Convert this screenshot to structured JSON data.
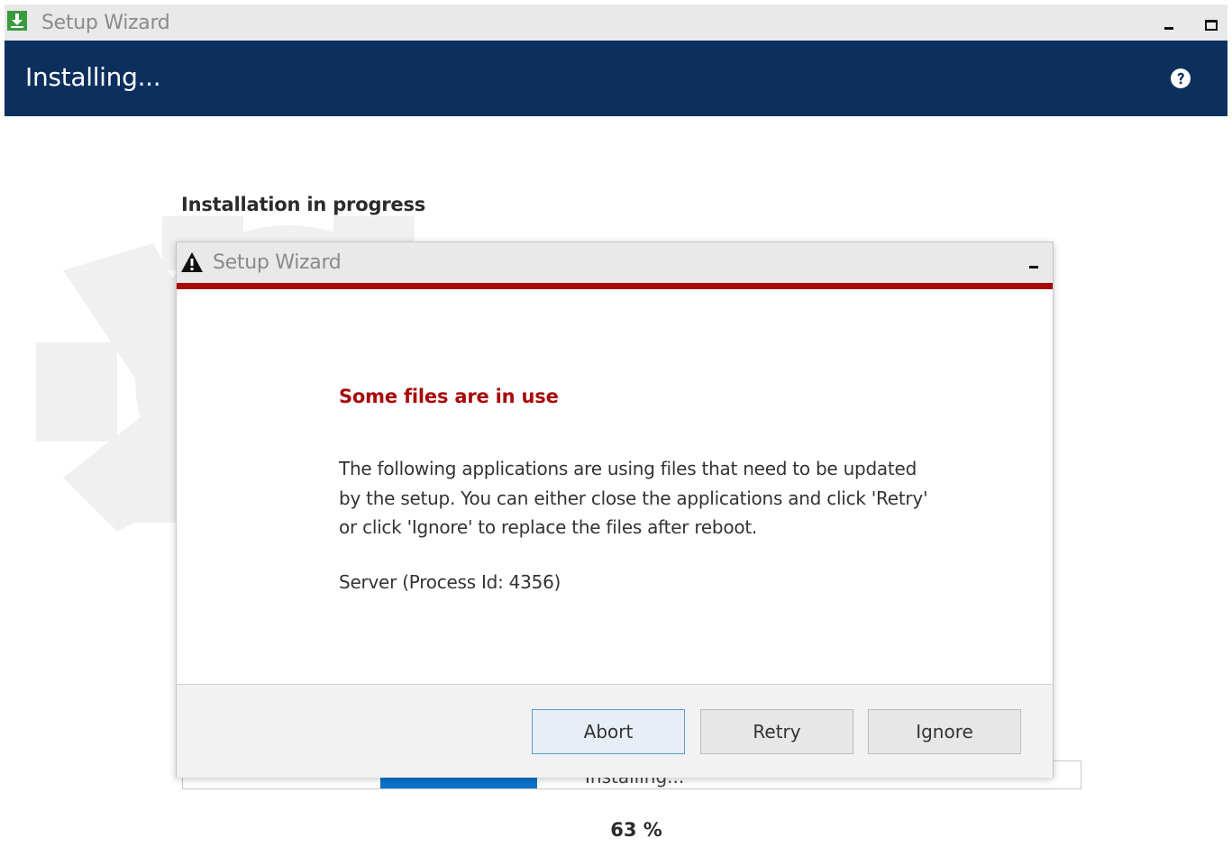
{
  "window": {
    "title": "Setup Wizard",
    "header_title": "Installing..."
  },
  "main": {
    "section_heading": "Installation in progress",
    "progress": {
      "status_text": "Installing...",
      "percent_label": "63 %",
      "value": 0.63
    }
  },
  "dialog": {
    "title": "Setup Wizard",
    "heading": "Some files are in use",
    "message_lines": [
      "The following applications are using files that need to be updated",
      "by the setup. You can either close the applications and click 'Retry'",
      "or click 'Ignore' to replace the files after reboot."
    ],
    "process": "Server (Process Id: 4356)",
    "buttons": {
      "abort": "Abort",
      "retry": "Retry",
      "ignore": "Ignore"
    }
  },
  "colors": {
    "header_bg": "#0d2f5e",
    "warning_red": "#a80a0a",
    "progress_blue": "#0a74c9",
    "app_icon_green": "#3a9b3d"
  },
  "icons": {
    "app": "setup-download-icon",
    "help": "help-icon",
    "warning": "warning-icon",
    "background": "gear-warning-background-icon"
  }
}
